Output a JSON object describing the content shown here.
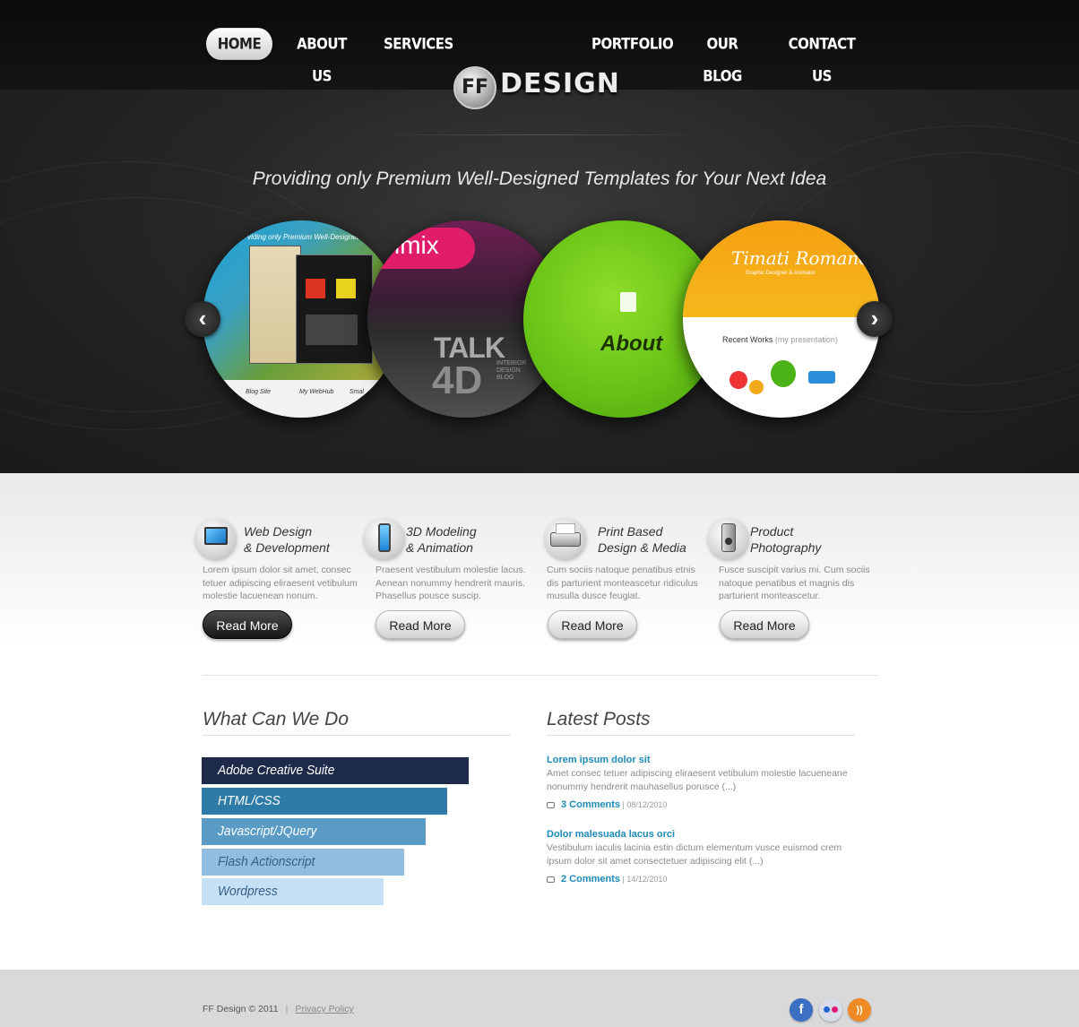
{
  "nav": {
    "home": "HOME",
    "about": "ABOUT US",
    "services": "SERVICES",
    "portfolio": "PORTFOLIO",
    "blog": "OUR BLOG",
    "contact": "CONTACT US"
  },
  "logo": {
    "badge": "FF",
    "text": "DESIGN"
  },
  "hero": {
    "tagline": "Providing only Premium Well-Designed Templates for Your Next Idea",
    "slides": {
      "s1_caption": "viding only Premium Well-Designed",
      "s1_tabs": [
        "Blog Site",
        "My WebHub",
        "Smal"
      ],
      "s2_top": "imix",
      "s2_big": "TALK",
      "s2_num": "4D",
      "s2_small": "INTERIOR DESIGN BLOG",
      "s3_label": "About",
      "s4_name": "Timati Romano",
      "s4_sub": "Graphic Designer & Animator",
      "s4_recent": "Recent Works",
      "s4_recent_sub": "(my presentation)"
    },
    "prev_icon": "chevron-left-icon",
    "next_icon": "chevron-right-icon"
  },
  "services": [
    {
      "title1": "Web Design",
      "title2": "& Development",
      "text": "Lorem ipsum dolor sit amet, consec tetuer adipiscing eliraesent vetibulum molestie lacuenean nonum.",
      "button": "Read More",
      "icon": "monitor-icon"
    },
    {
      "title1": "3D Modeling",
      "title2": "& Animation",
      "text": "Praesent vestibulum molestie lacus. Aenean nonummy hendrerit mauris. Phasellus pousce suscip.",
      "button": "Read More",
      "icon": "phone-icon"
    },
    {
      "title1": "Print Based",
      "title2": "Design & Media",
      "text": "Cum sociis natoque penatibus etnis dis parturient monteascetur ridiculus musulla dusce feugiat.",
      "button": "Read More",
      "icon": "printer-icon"
    },
    {
      "title1": "Product",
      "title2": "Photography",
      "text": "Fusce suscipit varius mi. Cum sociis natoque penatibus et magnis dis parturient monteascetur.",
      "button": "Read More",
      "icon": "speaker-icon"
    }
  ],
  "what_we_do": {
    "title": "What Can We Do",
    "skills": [
      {
        "label": "Adobe Creative Suite",
        "color": "#1e2a4a",
        "level": 1.0
      },
      {
        "label": "HTML/CSS",
        "color": "#2d7ba6",
        "level": 0.92
      },
      {
        "label": "Javascript/JQuery",
        "color": "#5a9cc5",
        "level": 0.84
      },
      {
        "label": "Flash Actionscript",
        "color": "#90bde0",
        "level": 0.76
      },
      {
        "label": "Wordpress",
        "color": "#c6e0f5",
        "level": 0.68
      }
    ]
  },
  "latest_posts": {
    "title": "Latest Posts",
    "posts": [
      {
        "title": "Lorem ipsum dolor sit",
        "text": "Amet consec tetuer adipiscing eliraesent vetibulum molestie lacueneane nonummy hendrerit mauhasellus poruscе (...)",
        "comments": "3 Comments",
        "date": "08/12/2010"
      },
      {
        "title": "Dolor malesuada lacus orci",
        "text": "Vestibulum iaculis lacinia estin dictum elementum vusce euismod crem ipsum dolor sit amet consectetuer adipiscing elit (...)",
        "comments": "2 Comments",
        "date": "14/12/2010"
      }
    ]
  },
  "footer": {
    "copyright": "FF Design  © 2011",
    "separator": "|",
    "privacy": "Privacy Policy",
    "social": [
      {
        "name": "facebook-icon",
        "glyph": "f",
        "color": "#3b6fc4"
      },
      {
        "name": "flickr-icon",
        "glyph": "••",
        "color": "#d8dde8"
      },
      {
        "name": "rss-icon",
        "glyph": "))",
        "color": "#f08a24"
      }
    ]
  },
  "colors": {
    "accent": "#1d8bb8",
    "dark": "#1a1a1a"
  }
}
